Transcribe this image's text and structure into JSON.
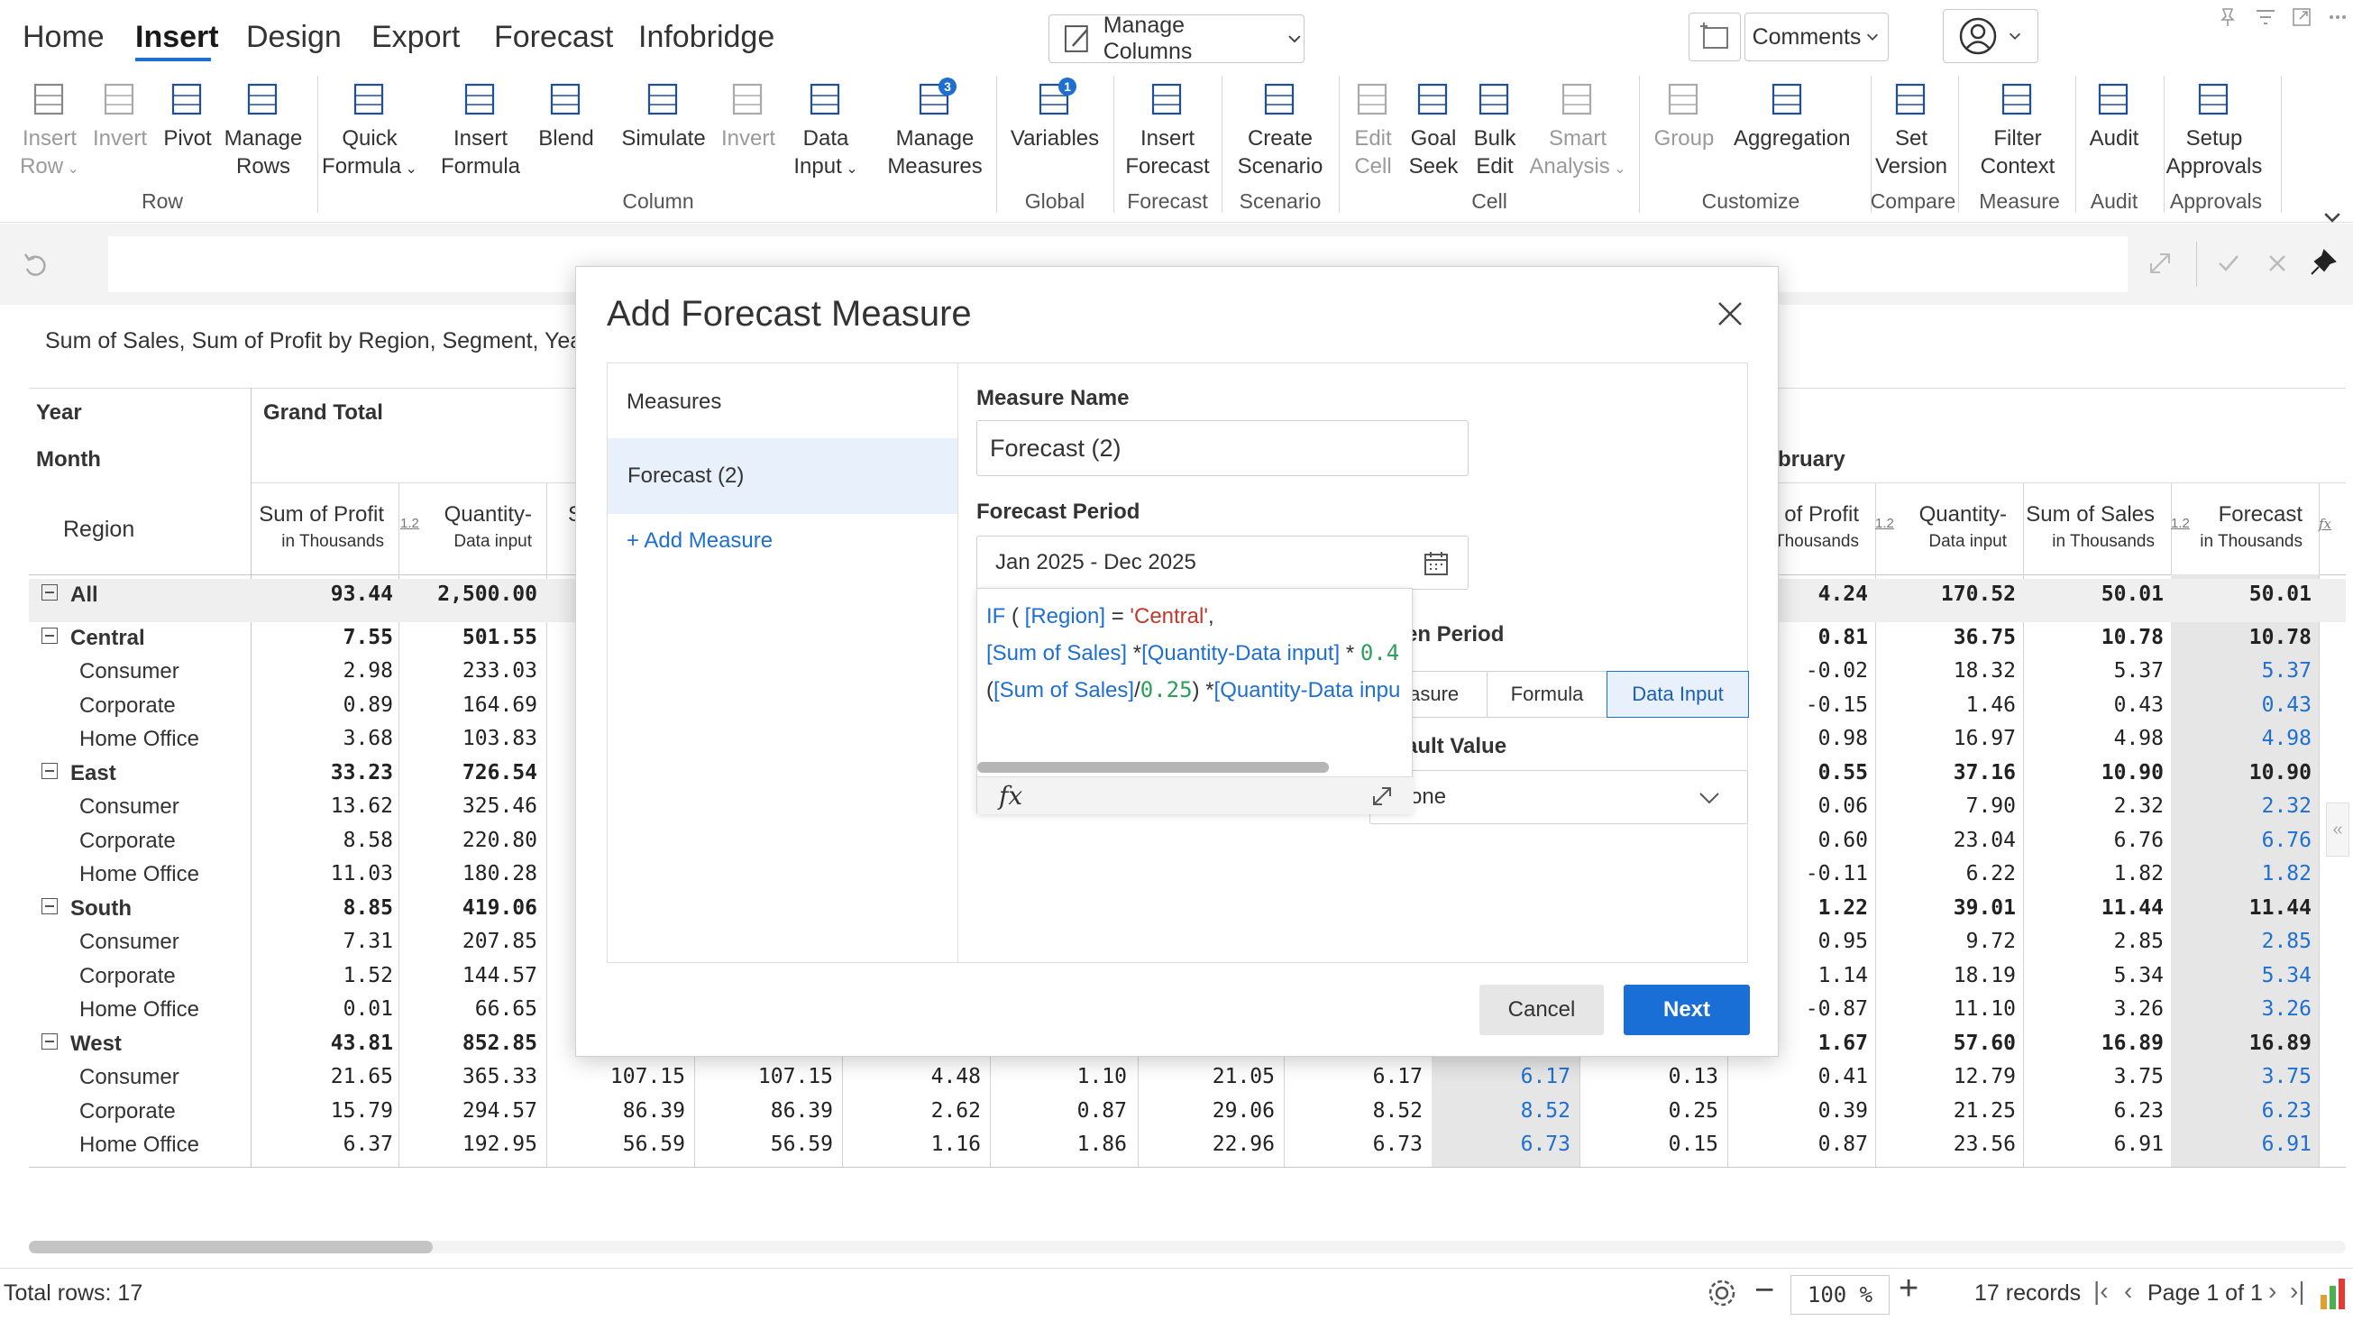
{
  "menu": {
    "tabs": [
      {
        "label": "Home"
      },
      {
        "label": "Insert"
      },
      {
        "label": "Design"
      },
      {
        "label": "Export"
      },
      {
        "label": "Forecast"
      },
      {
        "label": "Infobridge"
      }
    ],
    "manage_columns": "Manage Columns",
    "comments": "Comments"
  },
  "ribbon": {
    "items": [
      {
        "line1": "Insert",
        "line2": "Row",
        "dropdown": true,
        "disabled": true
      },
      {
        "line1": "Invert",
        "line2": "",
        "disabled": true
      },
      {
        "line1": "Pivot",
        "line2": ""
      },
      {
        "line1": "Manage",
        "line2": "Rows"
      },
      {
        "line1": "Quick",
        "line2": "Formula",
        "dropdown": true
      },
      {
        "line1": "Insert",
        "line2": "Formula"
      },
      {
        "line1": "Blend",
        "line2": ""
      },
      {
        "line1": "Simulate",
        "line2": ""
      },
      {
        "line1": "Invert",
        "line2": "",
        "disabled": true
      },
      {
        "line1": "Data",
        "line2": "Input",
        "dropdown": true
      },
      {
        "line1": "Manage",
        "line2": "Measures",
        "badge": "3"
      },
      {
        "line1": "Variables",
        "line2": "",
        "badge": "1"
      },
      {
        "line1": "Insert",
        "line2": "Forecast"
      },
      {
        "line1": "Create",
        "line2": "Scenario"
      },
      {
        "line1": "Edit",
        "line2": "Cell",
        "disabled": true
      },
      {
        "line1": "Goal",
        "line2": "Seek"
      },
      {
        "line1": "Bulk",
        "line2": "Edit"
      },
      {
        "line1": "Smart",
        "line2": "Analysis",
        "dropdown": true,
        "disabled": true
      },
      {
        "line1": "Group",
        "line2": "",
        "disabled": true
      },
      {
        "line1": "Aggregation",
        "line2": ""
      },
      {
        "line1": "Set",
        "line2": "Version"
      },
      {
        "line1": "Filter",
        "line2": "Context"
      },
      {
        "line1": "Audit",
        "line2": ""
      },
      {
        "line1": "Setup",
        "line2": "Approvals"
      }
    ],
    "groups": [
      "Row",
      "Column",
      "Global",
      "Forecast",
      "Scenario",
      "Cell",
      "Customize",
      "Compare",
      "Measure",
      "Audit",
      "Approvals"
    ]
  },
  "report": {
    "title": "Sum of Sales, Sum of Profit by Region, Segment, Year, M",
    "year_label": "Year",
    "month_label": "Month",
    "region_label": "Region",
    "grand_total": "Grand Total",
    "february": "bruary",
    "col_left": [
      {
        "l1": "Sum of Profit",
        "l2": "in Thousands",
        "badge": "1.2"
      },
      {
        "l1": "Quantity-",
        "l2": "Data input"
      },
      {
        "l1": "S",
        "l2": ""
      }
    ],
    "col_right": [
      {
        "l1": "n of Profit",
        "l2": "Thousands",
        "badge": "1.2"
      },
      {
        "l1": "Quantity-",
        "l2": "Data input"
      },
      {
        "l1": "Sum of Sales",
        "l2": "in Thousands",
        "badge": "1.2"
      },
      {
        "l1": "Forecast",
        "l2": "in Thousands",
        "badge": "fx"
      }
    ],
    "rows": [
      {
        "label": "All",
        "group": true,
        "l": [
          "93.44",
          "2,500.00"
        ],
        "m": [],
        "r": [
          "4.24",
          "170.52",
          "50.01",
          "50.01"
        ]
      },
      {
        "label": "Central",
        "group": true,
        "l": [
          "7.55",
          "501.55"
        ],
        "m": [],
        "r": [
          "0.81",
          "36.75",
          "10.78",
          "10.78"
        ]
      },
      {
        "label": "Consumer",
        "l": [
          "2.98",
          "233.03"
        ],
        "m": [],
        "r": [
          "-0.02",
          "18.32",
          "5.37",
          "5.37"
        ]
      },
      {
        "label": "Corporate",
        "l": [
          "0.89",
          "164.69"
        ],
        "m": [],
        "r": [
          "-0.15",
          "1.46",
          "0.43",
          "0.43"
        ]
      },
      {
        "label": "Home Office",
        "l": [
          "3.68",
          "103.83"
        ],
        "m": [],
        "r": [
          "0.98",
          "16.97",
          "4.98",
          "4.98"
        ]
      },
      {
        "label": "East",
        "group": true,
        "l": [
          "33.23",
          "726.54"
        ],
        "m": [],
        "r": [
          "0.55",
          "37.16",
          "10.90",
          "10.90"
        ]
      },
      {
        "label": "Consumer",
        "l": [
          "13.62",
          "325.46"
        ],
        "m": [],
        "r": [
          "0.06",
          "7.90",
          "2.32",
          "2.32"
        ]
      },
      {
        "label": "Corporate",
        "l": [
          "8.58",
          "220.80"
        ],
        "m": [],
        "r": [
          "0.60",
          "23.04",
          "6.76",
          "6.76"
        ]
      },
      {
        "label": "Home Office",
        "l": [
          "11.03",
          "180.28"
        ],
        "m": [],
        "r": [
          "-0.11",
          "6.22",
          "1.82",
          "1.82"
        ]
      },
      {
        "label": "South",
        "group": true,
        "l": [
          "8.85",
          "419.06"
        ],
        "m": [],
        "r": [
          "1.22",
          "39.01",
          "11.44",
          "11.44"
        ]
      },
      {
        "label": "Consumer",
        "l": [
          "7.31",
          "207.85"
        ],
        "m": [],
        "r": [
          "0.95",
          "9.72",
          "2.85",
          "2.85"
        ]
      },
      {
        "label": "Corporate",
        "l": [
          "1.52",
          "144.57"
        ],
        "m": [],
        "r": [
          "1.14",
          "18.19",
          "5.34",
          "5.34"
        ]
      },
      {
        "label": "Home Office",
        "l": [
          "0.01",
          "66.65"
        ],
        "m": [],
        "r": [
          "-0.87",
          "11.10",
          "3.26",
          "3.26"
        ]
      },
      {
        "label": "West",
        "group": true,
        "l": [
          "43.81",
          "852.85"
        ],
        "m": [],
        "r": [
          "1.67",
          "57.60",
          "16.89",
          "16.89"
        ]
      },
      {
        "label": "Consumer",
        "l": [
          "21.65",
          "365.33"
        ],
        "m": [
          "107.15",
          "107.15",
          "4.48",
          "1.10",
          "21.05",
          "6.17",
          "6.17",
          "0.13"
        ],
        "r": [
          "0.41",
          "12.79",
          "3.75",
          "3.75"
        ]
      },
      {
        "label": "Corporate",
        "l": [
          "15.79",
          "294.57"
        ],
        "m": [
          "86.39",
          "86.39",
          "2.62",
          "0.87",
          "29.06",
          "8.52",
          "8.52",
          "0.25"
        ],
        "r": [
          "0.39",
          "21.25",
          "6.23",
          "6.23"
        ]
      },
      {
        "label": "Home Office",
        "l": [
          "6.37",
          "192.95"
        ],
        "m": [
          "56.59",
          "56.59",
          "1.16",
          "1.86",
          "22.96",
          "6.73",
          "6.73",
          "0.15"
        ],
        "r": [
          "0.87",
          "23.56",
          "6.91",
          "6.91"
        ]
      }
    ]
  },
  "footer": {
    "total_rows": "Total rows: 17",
    "zoom": "100 %",
    "records": "17 records",
    "page": "Page 1 of 1"
  },
  "modal": {
    "title": "Add Forecast Measure",
    "measures_header": "Measures",
    "selected_measure": "Forecast (2)",
    "add_measure": "+ Add Measure",
    "measure_name_label": "Measure Name",
    "measure_name_value": "Forecast (2)",
    "forecast_period_label": "Forecast Period",
    "forecast_period_value": "Jan 2025 - Dec 2025",
    "period_label_partial": "en Period",
    "tabs": [
      "easure",
      "Formula",
      "Data Input"
    ],
    "active_tab": "Data Input",
    "default_value_label": "ault Value",
    "default_value": "one",
    "formula_lines": [
      [
        {
          "t": "IF",
          "c": "kw"
        },
        {
          "t": " ( ",
          "c": "op"
        },
        {
          "t": "[Region]",
          "c": "kw"
        },
        {
          "t": " = ",
          "c": "op"
        },
        {
          "t": "'Central'",
          "c": "str"
        },
        {
          "t": ",",
          "c": "op"
        }
      ],
      [
        {
          "t": "[Sum of Sales]",
          "c": "kw"
        },
        {
          "t": " *",
          "c": "op"
        },
        {
          "t": "[Quantity-Data input]",
          "c": "kw"
        },
        {
          "t": " * ",
          "c": "op"
        },
        {
          "t": "0.4",
          "c": "num"
        }
      ],
      [
        {
          "t": "(",
          "c": "op"
        },
        {
          "t": "[Sum of Sales]",
          "c": "kw"
        },
        {
          "t": "/",
          "c": "op"
        },
        {
          "t": "0.25",
          "c": "num"
        },
        {
          "t": ") *",
          "c": "op"
        },
        {
          "t": "[Quantity-Data inpu",
          "c": "kw"
        }
      ]
    ],
    "fx": "fx",
    "cancel": "Cancel",
    "next": "Next"
  },
  "colors": {
    "accent": "#1a6fd6",
    "link": "#1f6fd1",
    "string": "#c0392b",
    "number": "#2e9e5b",
    "forecast_cell": "#e6e6e6",
    "selected_bg": "#e8f0fb"
  }
}
